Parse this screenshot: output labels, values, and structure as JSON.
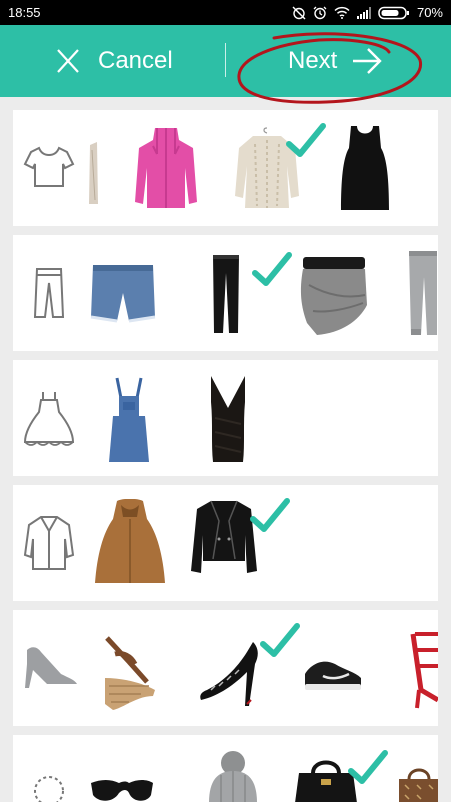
{
  "status_bar": {
    "time": "18:55",
    "battery": "70%"
  },
  "header": {
    "cancel_label": "Cancel",
    "next_label": "Next"
  },
  "colors": {
    "accent": "#2dbfa6",
    "annotation": "#b3151c",
    "checkmark": "#2dbfa6"
  },
  "categories": [
    {
      "name": "tops",
      "icon": "tshirt-icon",
      "items": [
        "cardigan-partial",
        "pink-sweater",
        "beige-knit-sweater",
        "black-tank-top"
      ],
      "selected": [
        "beige-knit-sweater"
      ]
    },
    {
      "name": "bottoms",
      "icon": "pants-icon",
      "items": [
        "denim-shorts",
        "black-skinny-jeans",
        "grey-draped-skirt",
        "grey-jogger-pants"
      ],
      "selected": [
        "black-skinny-jeans"
      ]
    },
    {
      "name": "dresses",
      "icon": "dress-icon",
      "items": [
        "denim-overall-dress",
        "black-bodycon-dress"
      ],
      "selected": []
    },
    {
      "name": "outerwear",
      "icon": "coat-icon",
      "items": [
        "brown-hooded-cape",
        "black-leather-jacket"
      ],
      "selected": [
        "black-leather-jacket"
      ]
    },
    {
      "name": "shoes",
      "icon": "shoe-icon",
      "items": [
        "grey-pointed-pump",
        "espadrille-wedge",
        "black-spiked-heel",
        "black-sneaker",
        "red-strappy-heel"
      ],
      "selected": [
        "black-spiked-heel"
      ]
    },
    {
      "name": "accessories",
      "icon": "necklace-icon",
      "items": [
        "black-sunglasses",
        "grey-pom-beanie",
        "black-handbag",
        "brown-monogram-bag"
      ],
      "selected": [
        "black-handbag"
      ]
    }
  ]
}
